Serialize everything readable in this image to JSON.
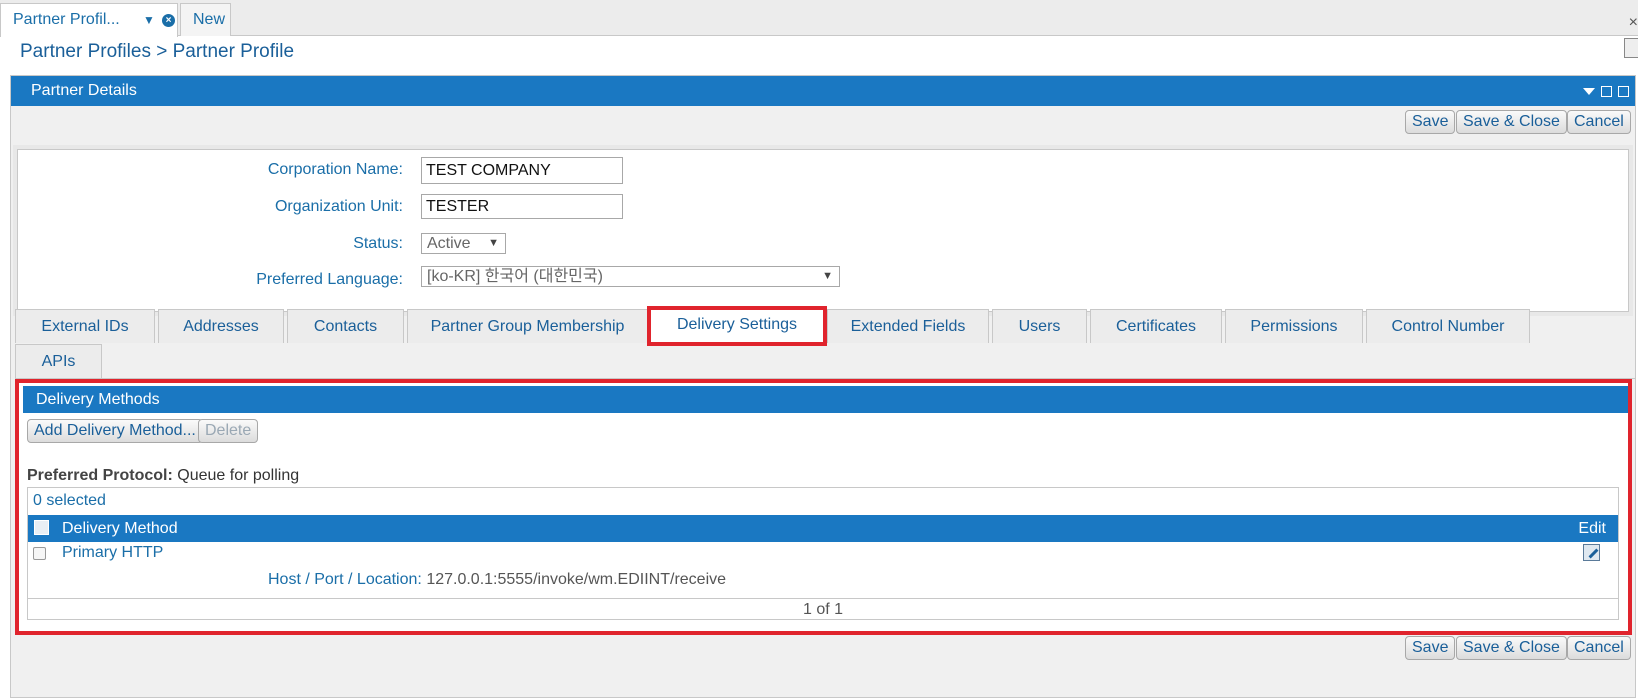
{
  "doc_tabs": [
    {
      "label": "Partner Profil...",
      "active": true
    },
    {
      "label": "New",
      "active": false
    }
  ],
  "breadcrumb": "Partner Profiles > Partner Profile",
  "panel": {
    "title": "Partner Details"
  },
  "buttons": {
    "save": "Save",
    "save_close": "Save & Close",
    "cancel": "Cancel"
  },
  "form": {
    "corporation_name": {
      "label": "Corporation Name:",
      "value": "TEST COMPANY"
    },
    "organization_unit": {
      "label": "Organization Unit:",
      "value": "TESTER"
    },
    "status": {
      "label": "Status:",
      "value": "Active"
    },
    "preferred_language": {
      "label": "Preferred Language:",
      "value": "[ko-KR] 한국어 (대한민국)"
    }
  },
  "tabs": [
    {
      "label": "External IDs"
    },
    {
      "label": "Addresses"
    },
    {
      "label": "Contacts"
    },
    {
      "label": "Partner Group Membership"
    },
    {
      "label": "Delivery Settings",
      "selected": true
    },
    {
      "label": "Extended Fields"
    },
    {
      "label": "Users"
    },
    {
      "label": "Certificates"
    },
    {
      "label": "Permissions"
    },
    {
      "label": "Control Number"
    },
    {
      "label": "APIs"
    }
  ],
  "delivery": {
    "header": "Delivery Methods",
    "add_button": "Add Delivery Method...",
    "delete_button": "Delete",
    "preferred_protocol_label": "Preferred Protocol:",
    "preferred_protocol_value": "Queue for polling",
    "selected_count": "0 selected",
    "columns": {
      "method": "Delivery Method",
      "edit": "Edit"
    },
    "rows": [
      {
        "name": "Primary HTTP",
        "detail_label": "Host / Port / Location:",
        "detail_value": "127.0.0.1:5555/invoke/wm.EDIINT/receive"
      }
    ],
    "pager": "1 of 1"
  },
  "colors": {
    "header_blue": "#1a78c2",
    "highlight_red": "#e0242d",
    "link_blue": "#1a6ea8"
  }
}
